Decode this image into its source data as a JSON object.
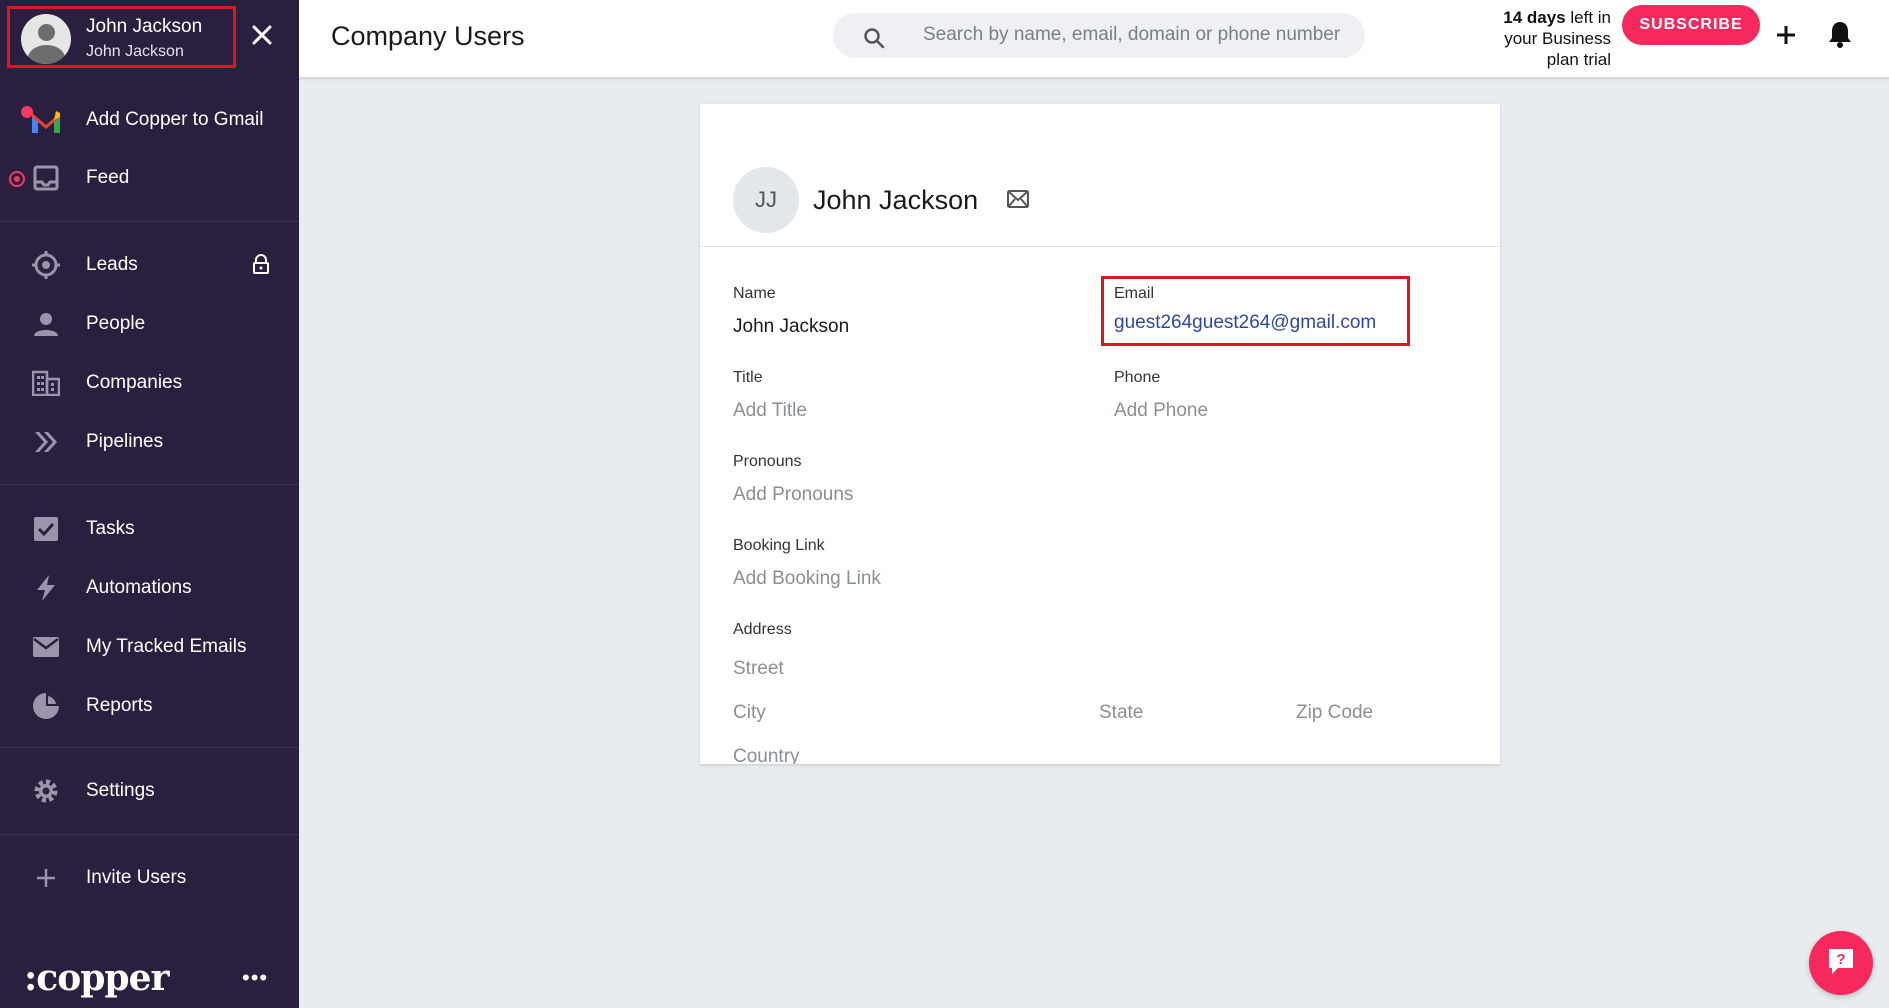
{
  "sidebar": {
    "user": {
      "name": "John Jackson",
      "subtitle": "John Jackson"
    },
    "items": [
      {
        "label": "Add Copper to Gmail",
        "icon": "gmail-icon"
      },
      {
        "label": "Feed",
        "icon": "inbox-icon"
      },
      {
        "label": "Leads",
        "icon": "target-icon"
      },
      {
        "label": "People",
        "icon": "person-icon"
      },
      {
        "label": "Companies",
        "icon": "building-icon"
      },
      {
        "label": "Pipelines",
        "icon": "chevrons-right-icon"
      },
      {
        "label": "Tasks",
        "icon": "checkbox-icon"
      },
      {
        "label": "Automations",
        "icon": "lightning-icon"
      },
      {
        "label": "My Tracked Emails",
        "icon": "envelope-icon"
      },
      {
        "label": "Reports",
        "icon": "pie-chart-icon"
      },
      {
        "label": "Settings",
        "icon": "gear-icon"
      },
      {
        "label": "Invite Users",
        "icon": "plus-icon"
      }
    ],
    "logo": ":copper",
    "more": "•••"
  },
  "header": {
    "title": "Company Users",
    "search_placeholder": "Search by name, email, domain or phone number",
    "trial_days": "14 days",
    "trial_rest_1": " left in",
    "trial_rest_2": "your Business",
    "trial_rest_3": "plan trial",
    "subscribe_label": "SUBSCRIBE"
  },
  "profile": {
    "initials": "JJ",
    "name": "John Jackson",
    "fields": {
      "name_label": "Name",
      "name_value": "John Jackson",
      "email_label": "Email",
      "email_value": "guest264guest264@gmail.com",
      "title_label": "Title",
      "title_placeholder": "Add Title",
      "phone_label": "Phone",
      "phone_placeholder": "Add Phone",
      "pronouns_label": "Pronouns",
      "pronouns_placeholder": "Add Pronouns",
      "booking_label": "Booking Link",
      "booking_placeholder": "Add Booking Link",
      "address_label": "Address",
      "street_placeholder": "Street",
      "city_placeholder": "City",
      "state_placeholder": "State",
      "zip_placeholder": "Zip Code",
      "country_placeholder": "Country"
    }
  },
  "colors": {
    "sidebar_bg": "#2b1f3f",
    "accent": "#f5295e",
    "highlight_border": "#e3141b",
    "link": "#2e47a6"
  }
}
